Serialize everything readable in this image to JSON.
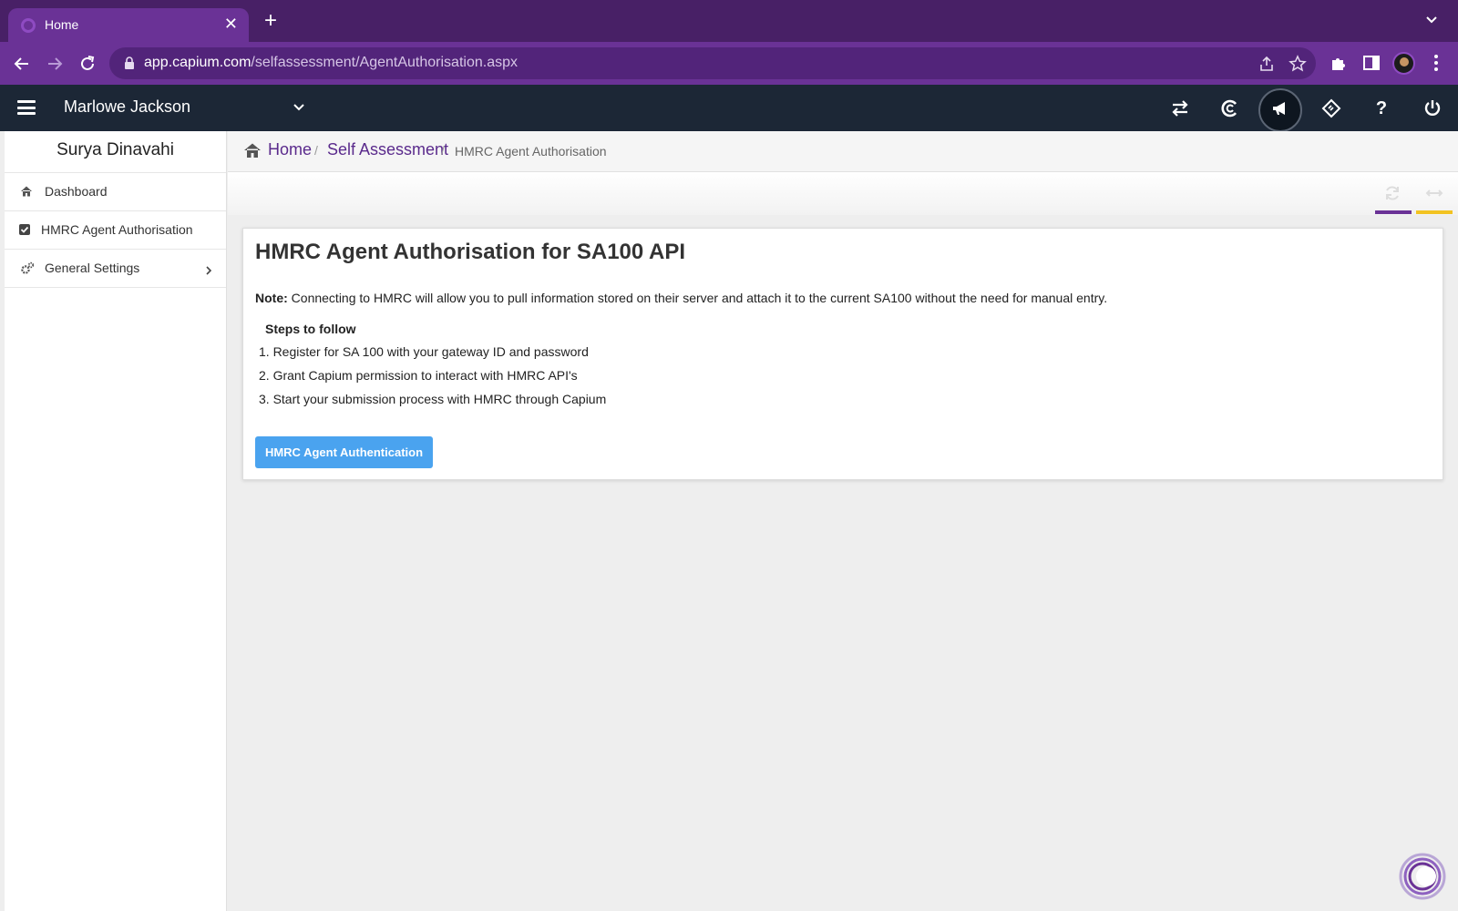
{
  "browser": {
    "tab_title": "Home",
    "tab_close": "✕",
    "new_tab": "+",
    "url_domain": "app.capium.com",
    "url_path": "/selfassessment/AgentAuthorisation.aspx"
  },
  "header": {
    "company_name": "Marlowe Jackson",
    "icons": [
      "switch-arrows-icon",
      "capium-logo-icon",
      "megaphone-icon",
      "ticket-icon",
      "help-icon",
      "power-icon"
    ],
    "help_glyph": "?"
  },
  "sidebar": {
    "user_name": "Surya Dinavahi",
    "items": [
      {
        "label": "Dashboard",
        "icon": "home-icon"
      },
      {
        "label": "HMRC Agent Authorisation",
        "icon": "checkbox-icon"
      },
      {
        "label": "General Settings",
        "icon": "gears-icon"
      }
    ]
  },
  "breadcrumb": {
    "home": "Home",
    "section": "Self Assessment",
    "current": "HMRC Agent Authorisation",
    "separator": "/"
  },
  "card": {
    "title": "HMRC Agent Authorisation for SA100 API",
    "note_label": "Note:",
    "note_text": " Connecting to HMRC will allow you to pull information stored on their server and attach it to the current SA100 without the need for manual entry.",
    "steps_title": "Steps to follow",
    "steps": [
      "1. Register for SA 100 with your gateway ID and password",
      "2. Grant Capium permission to interact with HMRC API's",
      "3. Start your submission process with HMRC through Capium"
    ],
    "button_label": "HMRC Agent Authentication"
  },
  "colors": {
    "brand_purple": "#6a3296",
    "header_dark": "#1c2736",
    "link_purple": "#5a2a8c",
    "button_blue": "#4aa3ef",
    "accent_yellow": "#f2c322"
  }
}
